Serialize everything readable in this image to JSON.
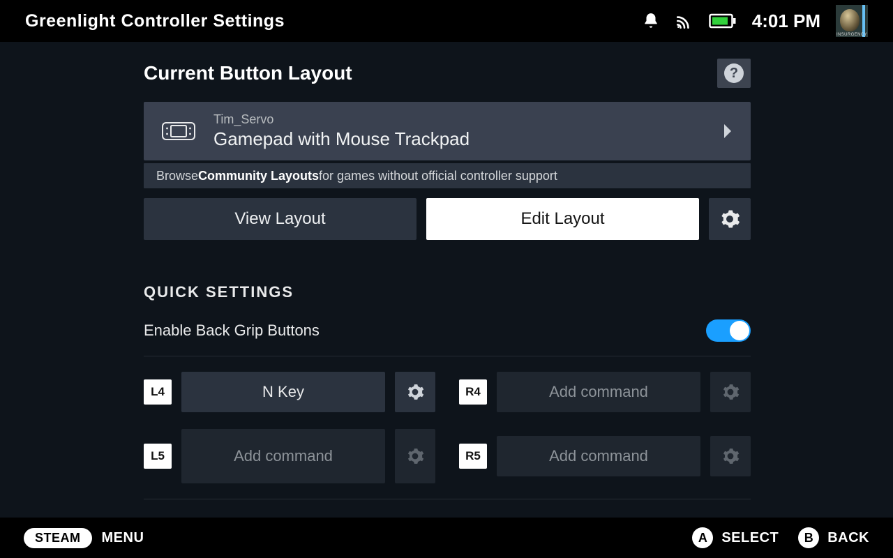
{
  "header": {
    "title": "Greenlight Controller Settings",
    "clock": "4:01 PM",
    "avatar_label": "INSURGENCY"
  },
  "layout_section": {
    "title": "Current Button Layout",
    "author": "Tim_Servo",
    "name": "Gamepad with Mouse Trackpad",
    "community_prefix": "Browse ",
    "community_bold": "Community Layouts",
    "community_suffix": " for games without official controller support",
    "view_label": "View Layout",
    "edit_label": "Edit Layout"
  },
  "quick": {
    "title": "QUICK SETTINGS",
    "toggle_label": "Enable Back Grip Buttons",
    "toggle_on": true,
    "grips": {
      "l4": {
        "tag": "L4",
        "command": "N Key",
        "placeholder": false
      },
      "r4": {
        "tag": "R4",
        "command": "Add command",
        "placeholder": true
      },
      "l5": {
        "tag": "L5",
        "command": "Add command",
        "placeholder": true
      },
      "r5": {
        "tag": "R5",
        "command": "Add command",
        "placeholder": true
      }
    }
  },
  "footer": {
    "steam": "STEAM",
    "menu": "MENU",
    "a_label": "SELECT",
    "b_label": "BACK",
    "a_glyph": "A",
    "b_glyph": "B"
  }
}
